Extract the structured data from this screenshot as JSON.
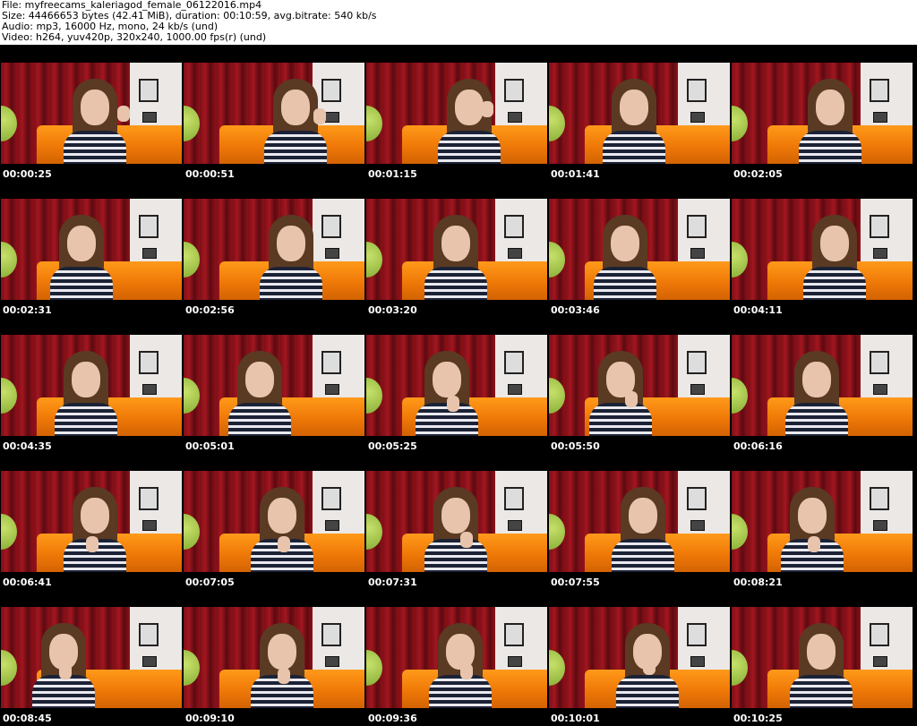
{
  "header": {
    "file_line": "File: myfreecams_kaleriagod_female_06122016.mp4",
    "size_line": "Size: 44466653 bytes (42.41 MiB), duration: 00:10:59, avg.bitrate: 540 kb/s",
    "audio_line": "Audio: mp3, 16000 Hz, mono, 24 kb/s (und)",
    "video_line": "Video: h264, yuv420p, 320x240, 1000.00 fps(r) (und)"
  },
  "thumbnails": [
    {
      "time": "00:00:25"
    },
    {
      "time": "00:00:51"
    },
    {
      "time": "00:01:15"
    },
    {
      "time": "00:01:41"
    },
    {
      "time": "00:02:05"
    },
    {
      "time": "00:02:31"
    },
    {
      "time": "00:02:56"
    },
    {
      "time": "00:03:20"
    },
    {
      "time": "00:03:46"
    },
    {
      "time": "00:04:11"
    },
    {
      "time": "00:04:35"
    },
    {
      "time": "00:05:01"
    },
    {
      "time": "00:05:25"
    },
    {
      "time": "00:05:50"
    },
    {
      "time": "00:06:16"
    },
    {
      "time": "00:06:41"
    },
    {
      "time": "00:07:05"
    },
    {
      "time": "00:07:31"
    },
    {
      "time": "00:07:55"
    },
    {
      "time": "00:08:21"
    },
    {
      "time": "00:08:45"
    },
    {
      "time": "00:09:10"
    },
    {
      "time": "00:09:36"
    },
    {
      "time": "00:10:01"
    },
    {
      "time": "00:10:25"
    }
  ],
  "colors": {
    "sheet_background": "#000000",
    "timestamp_text": "#ffffff",
    "curtain": "#8e1119",
    "couch": "#f07a08"
  }
}
